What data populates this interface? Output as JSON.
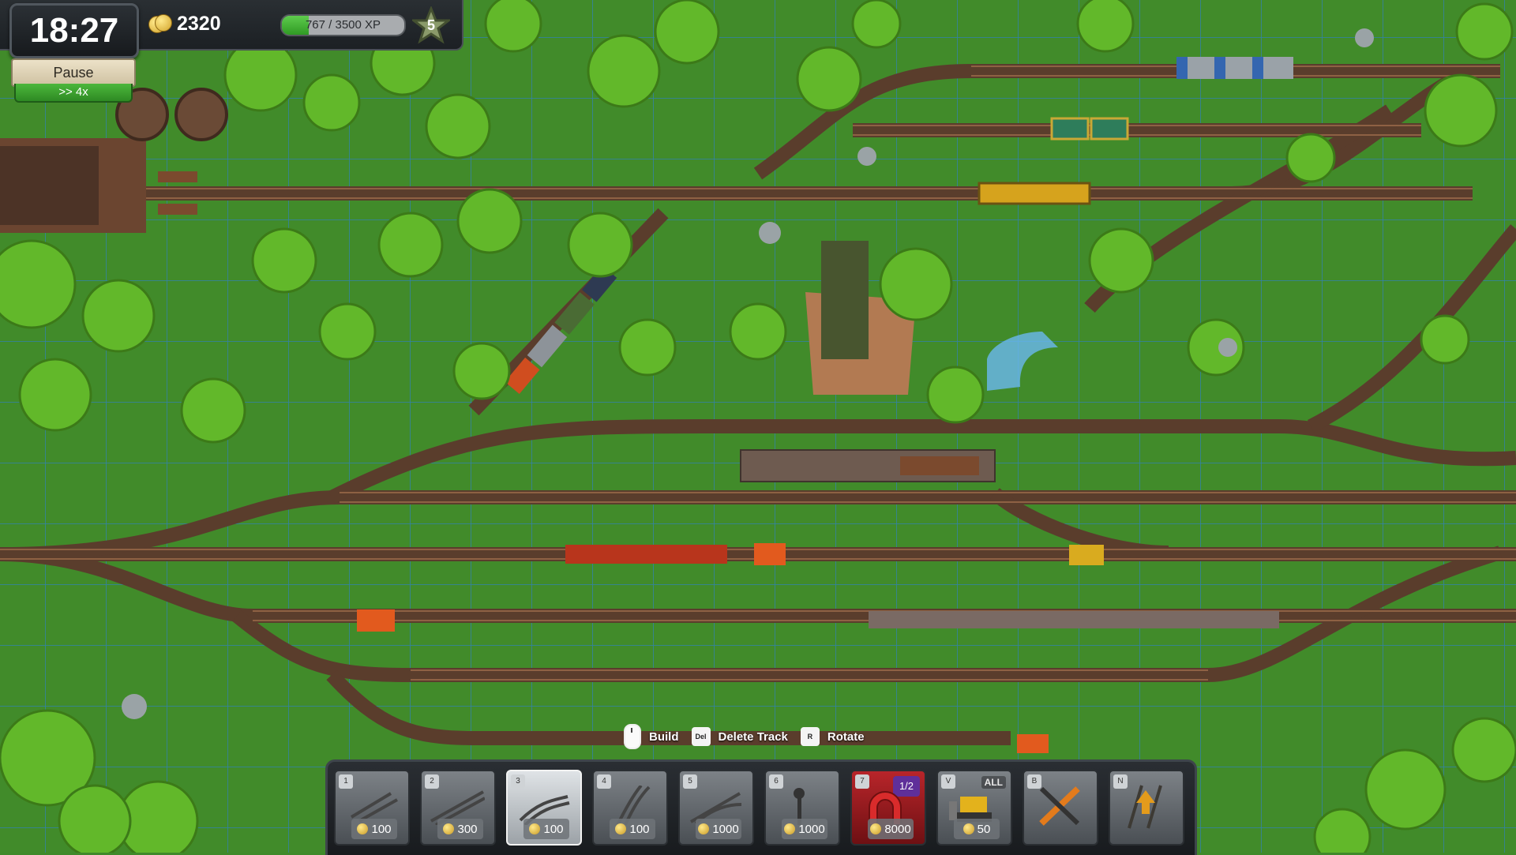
{
  "hud": {
    "clock": "18:27",
    "pause_label": "Pause",
    "speed_label": ">> 4x",
    "coins": "2320",
    "xp_text": "767 / 3500 XP",
    "xp_progress": 0.219,
    "level": "5"
  },
  "hints": [
    {
      "key": "mouse-left",
      "label": "Build"
    },
    {
      "key": "Del",
      "label": "Delete Track"
    },
    {
      "key": "R",
      "label": "Rotate"
    }
  ],
  "toolbar": {
    "slots": [
      {
        "key": "1",
        "item": "straight-track-short",
        "price": "100"
      },
      {
        "key": "2",
        "item": "straight-track-long",
        "price": "300"
      },
      {
        "key": "3",
        "item": "curved-track",
        "price": "100",
        "selected": true
      },
      {
        "key": "4",
        "item": "curved-track-wide",
        "price": "100"
      },
      {
        "key": "5",
        "item": "switch-track",
        "price": "1000"
      },
      {
        "key": "6",
        "item": "signal",
        "price": "1000"
      },
      {
        "key": "7",
        "item": "magnet",
        "price": "8000",
        "badge": "1/2"
      },
      {
        "key": "V",
        "item": "bulldozer",
        "price": "50",
        "badge": "ALL"
      },
      {
        "key": "B",
        "item": "tools-icon"
      },
      {
        "key": "N",
        "item": "upgrade-track-icon"
      }
    ]
  },
  "colors": {
    "grass": "#3f8a2a",
    "grid": "#2f7fc4",
    "rail": "#5a3d2c",
    "tree": "#5fbf2a"
  }
}
